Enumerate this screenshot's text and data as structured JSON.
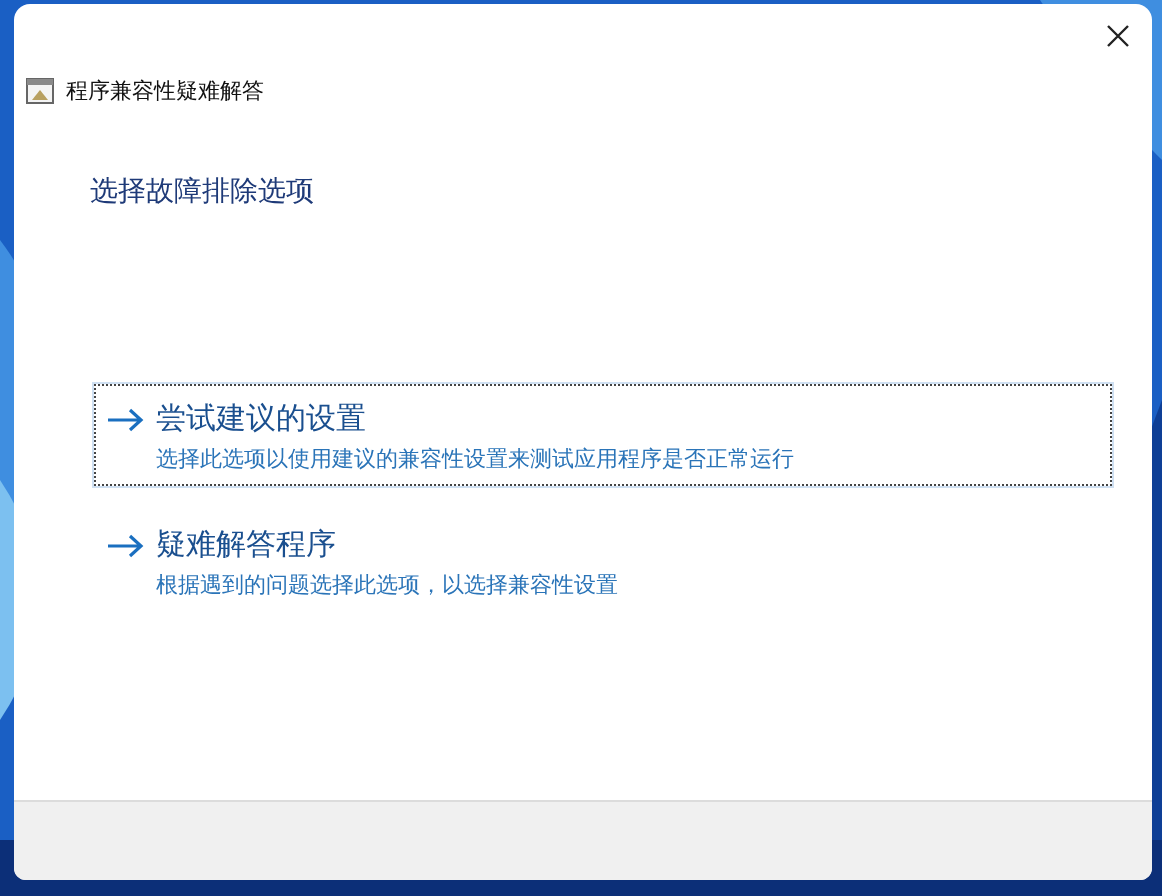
{
  "window": {
    "title": "程序兼容性疑难解答"
  },
  "heading": "选择故障排除选项",
  "options": [
    {
      "title": "尝试建议的设置",
      "description": "选择此选项以使用建议的兼容性设置来测试应用程序是否正常运行",
      "selected": true
    },
    {
      "title": "疑难解答程序",
      "description": "根据遇到的问题选择此选项，以选择兼容性设置",
      "selected": false
    }
  ]
}
